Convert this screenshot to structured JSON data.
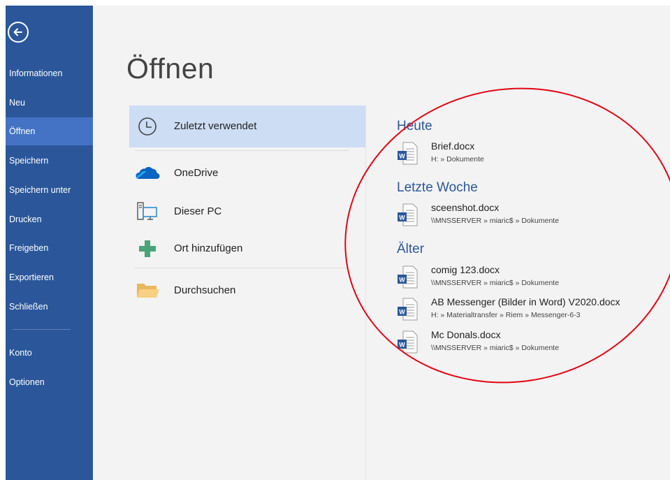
{
  "sidebar": {
    "items": [
      {
        "label": "Informationen"
      },
      {
        "label": "Neu"
      },
      {
        "label": "Öffnen"
      },
      {
        "label": "Speichern"
      },
      {
        "label": "Speichern unter"
      },
      {
        "label": "Drucken"
      },
      {
        "label": "Freigeben"
      },
      {
        "label": "Exportieren"
      },
      {
        "label": "Schließen"
      },
      {
        "label": "Konto"
      },
      {
        "label": "Optionen"
      }
    ]
  },
  "main": {
    "title": "Öffnen",
    "locations": [
      {
        "label": "Zuletzt verwendet",
        "icon": "clock-icon"
      },
      {
        "label": "OneDrive",
        "icon": "onedrive-cloud-icon"
      },
      {
        "label": "Dieser PC",
        "icon": "computer-icon"
      },
      {
        "label": "Ort hinzufügen",
        "icon": "plus-icon"
      },
      {
        "label": "Durchsuchen",
        "icon": "folder-icon"
      }
    ],
    "groups": [
      {
        "heading": "Heute",
        "files": [
          {
            "name": "Brief.docx",
            "path": "H: » Dokumente"
          }
        ]
      },
      {
        "heading": "Letzte Woche",
        "files": [
          {
            "name": "sceenshot.docx",
            "path": "\\\\MNSSERVER » miaric$ » Dokumente"
          }
        ]
      },
      {
        "heading": "Älter",
        "files": [
          {
            "name": "comig 123.docx",
            "path": "\\\\MNSSERVER » miaric$ » Dokumente"
          },
          {
            "name": "AB Messenger (Bilder in Word) V2020.docx",
            "path": "H: » Materialtransfer » Riem » Messenger-6-3"
          },
          {
            "name": "Mc Donals.docx",
            "path": "\\\\MNSSERVER » miaric$ » Dokumente"
          }
        ]
      }
    ]
  },
  "colors": {
    "sidebar": "#2b579a",
    "sidebar_active": "#4472c4",
    "selected_location": "#cdddf4",
    "heading": "#2b579a",
    "annotation_circle": "#e30613"
  }
}
